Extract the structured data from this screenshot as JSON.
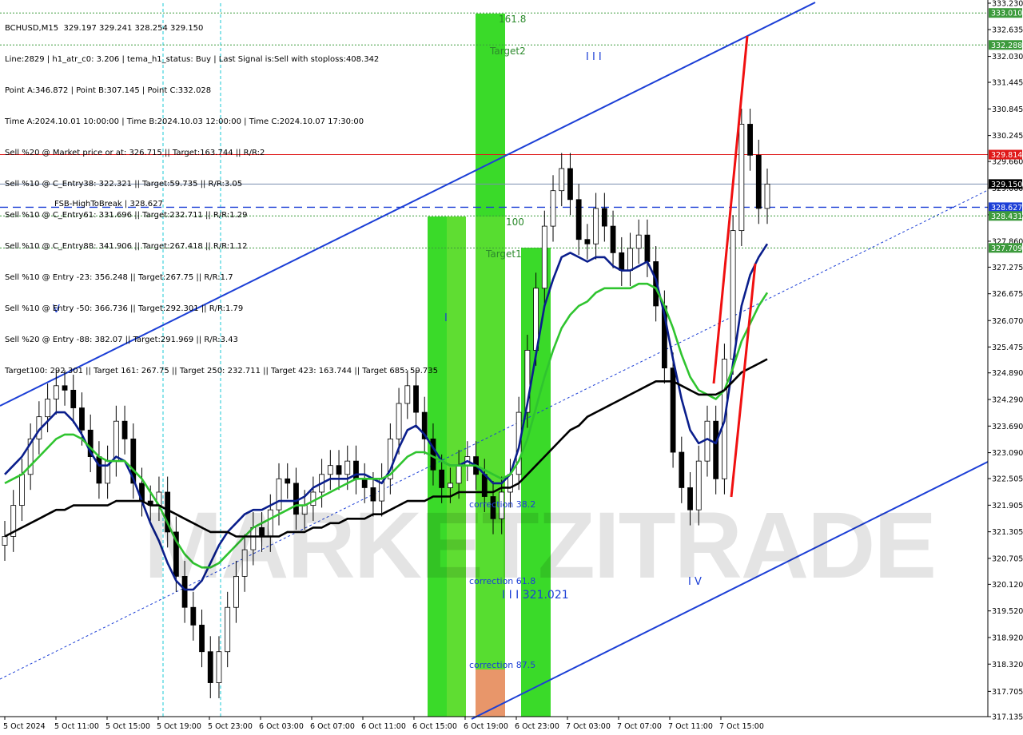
{
  "header": {
    "symbol": "BCHUSD,M15",
    "ohlc": "329.197 329.241 328.254 329.150",
    "lines": [
      "Line:2829 | h1_atr_c0: 3.206 | tema_h1_status: Buy | Last Signal is:Sell with stoploss:408.342",
      "Point A:346.872 | Point B:307.145 | Point C:332.028",
      "Time A:2024.10.01 10:00:00 | Time B:2024.10.03 12:00:00 | Time C:2024.10.07 17:30:00",
      "Sell %20 @ Market price or at: 326.715 || Target:163.744 || R/R:2",
      "Sell %10 @ C_Entry38: 322.321 || Target:59.735 || R/R:3.05",
      "Sell %10 @ C_Entry61: 331.696 || Target:232.711 || R/R:1.29",
      "Sell %10 @ C_Entry88: 341.906 || Target:267.418 || R/R:1.12",
      "Sell %10 @ Entry -23: 356.248 || Target:267.75 || R/R:1.7",
      "Sell %10 @ Entry -50: 366.736 || Target:292.301 || R/R:1.79",
      "Sell %20 @ Entry -88: 382.07 || Target:291.969 || R/R:3.43",
      "Target100: 292.301 || Target 161: 267.75 || Target 250: 232.711 || Target 423: 163.744 || Target 685: 59.735"
    ]
  },
  "watermark": "MARKETZITRADE",
  "chart_data": {
    "type": "line",
    "title": "BCHUSD,M15",
    "ylim": [
      317.135,
      333.23
    ],
    "yticks": [
      "333.230",
      "332.635",
      "332.030",
      "331.445",
      "330.845",
      "330.245",
      "329.660",
      "329.060",
      "328.455",
      "327.860",
      "327.275",
      "326.675",
      "326.070",
      "325.475",
      "324.890",
      "324.290",
      "323.690",
      "323.090",
      "322.505",
      "321.905",
      "321.305",
      "320.705",
      "320.120",
      "319.520",
      "318.920",
      "318.320",
      "317.705",
      "317.135"
    ],
    "xticks": [
      "5 Oct 2024",
      "5 Oct 11:00",
      "5 Oct 15:00",
      "5 Oct 19:00",
      "5 Oct 23:00",
      "6 Oct 03:00",
      "6 Oct 07:00",
      "6 Oct 11:00",
      "6 Oct 15:00",
      "6 Oct 19:00",
      "6 Oct 23:00",
      "7 Oct 03:00",
      "7 Oct 07:00",
      "7 Oct 11:00",
      "7 Oct 15:00"
    ],
    "price_badges": [
      {
        "value": 333.01,
        "label": "333.010",
        "color": "#3c9a3c"
      },
      {
        "value": 332.288,
        "label": "332.288",
        "color": "#3c9a3c"
      },
      {
        "value": 329.814,
        "label": "329.814",
        "color": "#e01818"
      },
      {
        "value": 329.15,
        "label": "329.150",
        "color": "#000000"
      },
      {
        "value": 328.627,
        "label": "328.627",
        "color": "#1c3fd6"
      },
      {
        "value": 328.431,
        "label": "328.431",
        "color": "#3c9a3c"
      },
      {
        "value": 327.709,
        "label": "327.709",
        "color": "#3c9a3c"
      }
    ],
    "horizontal_lines": [
      {
        "value": 333.01,
        "style": "dotted",
        "color": "#3c9a3c"
      },
      {
        "value": 332.288,
        "style": "dotted",
        "color": "#3c9a3c"
      },
      {
        "value": 329.814,
        "style": "solid",
        "color": "#e01818"
      },
      {
        "value": 329.15,
        "style": "solid",
        "color": "#7b8fb0"
      },
      {
        "value": 328.627,
        "style": "dashed",
        "color": "#1c3fd6"
      },
      {
        "value": 328.431,
        "style": "dotted",
        "color": "#3c9a3c"
      },
      {
        "value": 327.709,
        "style": "dotted",
        "color": "#3c9a3c"
      }
    ],
    "fsb_label": "FSB-HighToBreak | 328.627",
    "fib_labels": [
      "161.8",
      "Target2",
      "100",
      "Target1",
      "correction 38.2",
      "correction 61.8",
      "correction 87.5"
    ],
    "wave_labels": [
      "V",
      "I",
      "I I I",
      "I V",
      "I I I 321.021"
    ],
    "series": [
      {
        "name": "close",
        "color": "#000000",
        "values": [
          321.2,
          321.9,
          322.6,
          323.4,
          323.9,
          324.3,
          324.6,
          324.5,
          324.1,
          323.6,
          323.0,
          322.4,
          322.9,
          323.8,
          323.4,
          322.4,
          322.0,
          321.9,
          322.2,
          321.3,
          320.3,
          319.6,
          319.2,
          318.6,
          317.9,
          318.6,
          319.6,
          320.3,
          320.9,
          321.4,
          321.2,
          321.8,
          322.5,
          322.4,
          321.7,
          321.9,
          322.2,
          322.6,
          322.8,
          322.6,
          322.9,
          322.5,
          322.3,
          322.0,
          322.5,
          323.4,
          324.2,
          324.6,
          324.0,
          323.4,
          322.7,
          322.3,
          322.4,
          322.8,
          323.0,
          322.6,
          322.1,
          321.6,
          322.2,
          322.6,
          324.0,
          325.4,
          326.8,
          328.2,
          329.0,
          329.5,
          328.8,
          327.9,
          327.8,
          328.6,
          328.2,
          327.6,
          327.2,
          327.7,
          328.0,
          327.4,
          326.4,
          325.0,
          323.1,
          322.3,
          321.8,
          322.9,
          323.8,
          322.5,
          325.2,
          328.1,
          330.5,
          329.8,
          328.6,
          329.15
        ]
      },
      {
        "name": "ema_fast",
        "color": "#0a1e8c",
        "values": [
          322.6,
          322.8,
          323.0,
          323.3,
          323.6,
          323.8,
          324.0,
          324.0,
          323.8,
          323.5,
          323.1,
          322.8,
          322.8,
          323.0,
          322.9,
          322.5,
          322.0,
          321.5,
          321.1,
          320.6,
          320.2,
          320.0,
          320.0,
          320.2,
          320.6,
          321.0,
          321.3,
          321.5,
          321.7,
          321.8,
          321.8,
          321.9,
          322.0,
          322.0,
          322.0,
          322.1,
          322.3,
          322.4,
          322.5,
          322.5,
          322.5,
          322.6,
          322.6,
          322.5,
          322.4,
          322.7,
          323.2,
          323.6,
          323.7,
          323.5,
          323.2,
          322.9,
          322.8,
          322.8,
          322.9,
          322.8,
          322.6,
          322.4,
          322.4,
          322.6,
          323.2,
          324.2,
          325.3,
          326.4,
          327.0,
          327.5,
          327.6,
          327.5,
          327.4,
          327.5,
          327.5,
          327.3,
          327.2,
          327.2,
          327.3,
          327.4,
          327.0,
          326.2,
          325.2,
          324.3,
          323.6,
          323.3,
          323.4,
          323.3,
          323.8,
          325.1,
          326.4,
          327.1,
          327.5,
          327.8
        ]
      },
      {
        "name": "ema_mid",
        "color": "#2fc42f",
        "values": [
          322.4,
          322.5,
          322.6,
          322.8,
          323.0,
          323.2,
          323.4,
          323.5,
          323.5,
          323.4,
          323.2,
          323.0,
          322.9,
          322.9,
          322.9,
          322.7,
          322.5,
          322.2,
          321.9,
          321.5,
          321.1,
          320.8,
          320.6,
          320.5,
          320.5,
          320.6,
          320.8,
          321.0,
          321.2,
          321.4,
          321.5,
          321.6,
          321.7,
          321.8,
          321.9,
          321.9,
          322.0,
          322.1,
          322.2,
          322.3,
          322.4,
          322.5,
          322.5,
          322.5,
          322.5,
          322.6,
          322.8,
          323.0,
          323.1,
          323.1,
          323.0,
          322.9,
          322.8,
          322.8,
          322.8,
          322.8,
          322.7,
          322.6,
          322.5,
          322.6,
          322.9,
          323.4,
          324.1,
          324.8,
          325.4,
          325.9,
          326.2,
          326.4,
          326.5,
          326.7,
          326.8,
          326.8,
          326.8,
          326.8,
          326.9,
          326.9,
          326.8,
          326.4,
          325.9,
          325.3,
          324.8,
          324.5,
          324.4,
          324.3,
          324.5,
          325.0,
          325.6,
          326.0,
          326.4,
          326.7
        ]
      },
      {
        "name": "ema_slow",
        "color": "#000000",
        "values": [
          321.2,
          321.3,
          321.4,
          321.5,
          321.6,
          321.7,
          321.8,
          321.8,
          321.9,
          321.9,
          321.9,
          321.9,
          321.9,
          322.0,
          322.0,
          322.0,
          322.0,
          321.9,
          321.9,
          321.8,
          321.7,
          321.6,
          321.5,
          321.4,
          321.3,
          321.3,
          321.3,
          321.2,
          321.2,
          321.2,
          321.2,
          321.2,
          321.2,
          321.3,
          321.3,
          321.3,
          321.4,
          321.4,
          321.5,
          321.5,
          321.6,
          321.6,
          321.6,
          321.7,
          321.7,
          321.8,
          321.9,
          322.0,
          322.0,
          322.0,
          322.1,
          322.1,
          322.1,
          322.2,
          322.2,
          322.2,
          322.2,
          322.2,
          322.3,
          322.3,
          322.4,
          322.6,
          322.8,
          323.0,
          323.2,
          323.4,
          323.6,
          323.7,
          323.9,
          324.0,
          324.1,
          324.2,
          324.3,
          324.4,
          324.5,
          324.6,
          324.7,
          324.7,
          324.7,
          324.6,
          324.5,
          324.4,
          324.4,
          324.4,
          324.5,
          324.7,
          324.9,
          325.0,
          325.1,
          325.2
        ]
      }
    ],
    "grid": false
  }
}
